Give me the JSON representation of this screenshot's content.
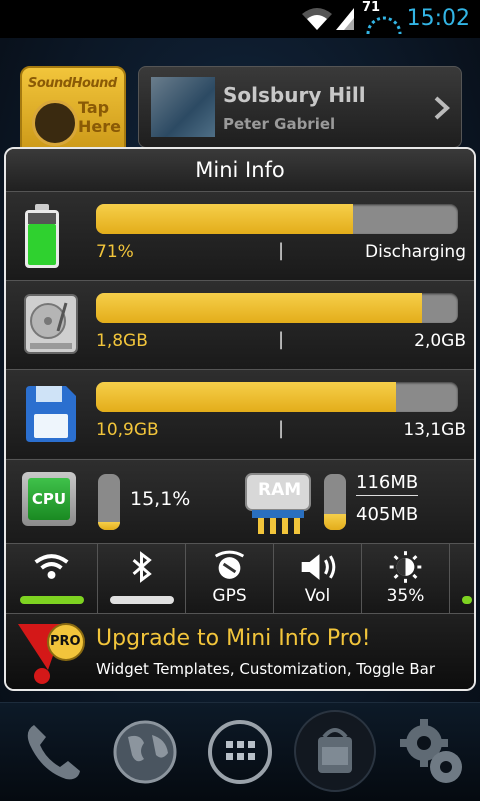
{
  "status_bar": {
    "battery_level": "71",
    "time": "15:02"
  },
  "background_widgets": {
    "soundhound": {
      "brand": "SoundHound",
      "action": "Tap Here"
    },
    "music": {
      "song": "Solsbury Hill",
      "artist": "Peter Gabriel"
    }
  },
  "mini_info": {
    "title": "Mini Info",
    "battery": {
      "percent_text": "71%",
      "fill_fraction": 0.71,
      "separator": "|",
      "status": "Discharging"
    },
    "storage_internal": {
      "used": "1,8GB",
      "fill_fraction": 0.9,
      "separator": "|",
      "total": "2,0GB"
    },
    "storage_sd": {
      "used": "10,9GB",
      "fill_fraction": 0.83,
      "separator": "|",
      "total": "13,1GB"
    },
    "cpu": {
      "label": "CPU",
      "usage": "15,1%",
      "fill_fraction": 0.151
    },
    "ram": {
      "label": "RAM",
      "used": "116MB",
      "total": "405MB",
      "fill_fraction": 0.29
    },
    "toggles": [
      {
        "id": "wifi",
        "label": "",
        "bar_color": "#7ed321"
      },
      {
        "id": "bluetooth",
        "label": "",
        "bar_color": "#e0e0e0"
      },
      {
        "id": "gps",
        "label": "GPS"
      },
      {
        "id": "vol",
        "label": "Vol"
      },
      {
        "id": "brightness",
        "label": "35%"
      }
    ],
    "upgrade": {
      "badge": "PRO",
      "title": "Upgrade to Mini Info Pro!",
      "subtitle": "Widget Templates, Customization, Toggle Bar"
    }
  },
  "dock": {
    "items": [
      "phone-icon",
      "browser-globe-icon",
      "app-drawer-icon",
      "market-icon",
      "settings-icon"
    ]
  },
  "colors": {
    "accent_yellow": "#f2c53b",
    "clock_blue": "#33b5e5",
    "wifi_green": "#7ed321"
  }
}
